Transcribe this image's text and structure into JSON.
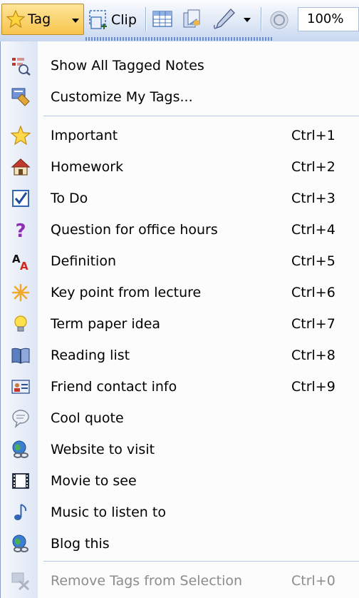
{
  "toolbar": {
    "tag_label": "Tag",
    "clip_label": "Clip",
    "zoom_value": "100%"
  },
  "menu": {
    "top_items": [
      {
        "label": "Show All Tagged Notes",
        "icon": "tagged-notes-search-icon"
      },
      {
        "label": "Customize My Tags...",
        "icon": "customize-tags-icon"
      }
    ],
    "tags": [
      {
        "label": "Important",
        "shortcut": "Ctrl+1",
        "icon": "star-icon"
      },
      {
        "label": "Homework",
        "shortcut": "Ctrl+2",
        "icon": "house-icon"
      },
      {
        "label": "To Do",
        "shortcut": "Ctrl+3",
        "icon": "checkbox-icon"
      },
      {
        "label": "Question for office hours",
        "shortcut": "Ctrl+4",
        "icon": "question-mark-icon"
      },
      {
        "label": "Definition",
        "shortcut": "Ctrl+5",
        "icon": "definition-letters-icon"
      },
      {
        "label": "Key point from lecture",
        "shortcut": "Ctrl+6",
        "icon": "asterisk-icon"
      },
      {
        "label": "Term paper idea",
        "shortcut": "Ctrl+7",
        "icon": "lightbulb-icon"
      },
      {
        "label": "Reading list",
        "shortcut": "Ctrl+8",
        "icon": "open-book-icon"
      },
      {
        "label": "Friend contact info",
        "shortcut": "Ctrl+9",
        "icon": "contact-card-icon"
      },
      {
        "label": "Cool quote",
        "shortcut": "",
        "icon": "speech-bubble-icon"
      },
      {
        "label": "Website to visit",
        "shortcut": "",
        "icon": "globe-link-icon"
      },
      {
        "label": "Movie to see",
        "shortcut": "",
        "icon": "film-icon"
      },
      {
        "label": "Music to listen to",
        "shortcut": "",
        "icon": "music-note-icon"
      },
      {
        "label": "Blog this",
        "shortcut": "",
        "icon": "globe-link-icon"
      }
    ],
    "remove_item": {
      "label": "Remove Tags from Selection",
      "shortcut": "Ctrl+0",
      "icon": "remove-tags-icon",
      "disabled": true
    }
  }
}
